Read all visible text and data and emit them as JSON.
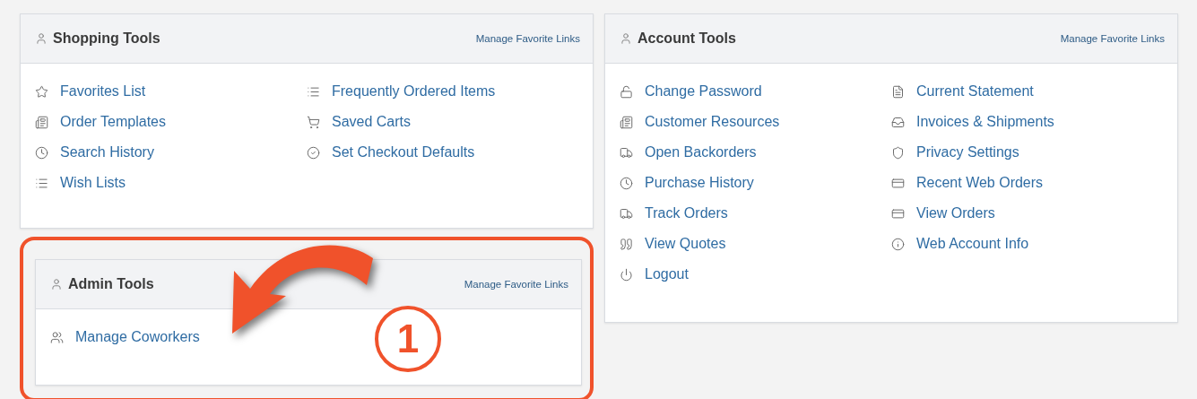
{
  "panels": [
    {
      "title": "Shopping Tools",
      "manage_link": "Manage Favorite Links",
      "highlighted": false,
      "columns": [
        [
          "Favorites List",
          "Order Templates",
          "Search History",
          "Wish Lists"
        ],
        [
          "Frequently Ordered Items",
          "Saved Carts",
          "Set Checkout Defaults"
        ]
      ]
    },
    {
      "title": "Admin Tools",
      "manage_link": "Manage Favorite Links",
      "highlighted": true,
      "columns": [
        [
          "Manage Coworkers"
        ]
      ]
    },
    {
      "title": "Account Tools",
      "manage_link": "Manage Favorite Links",
      "highlighted": false,
      "columns": [
        [
          "Change Password",
          "Customer Resources",
          "Open Backorders",
          "Purchase History",
          "Track Orders",
          "View Quotes",
          "Logout"
        ],
        [
          "Current Statement",
          "Invoices & Shipments",
          "Privacy Settings",
          "Recent Web Orders",
          "View Orders",
          "Web Account Info"
        ]
      ]
    }
  ],
  "annotation": {
    "step": "1"
  }
}
